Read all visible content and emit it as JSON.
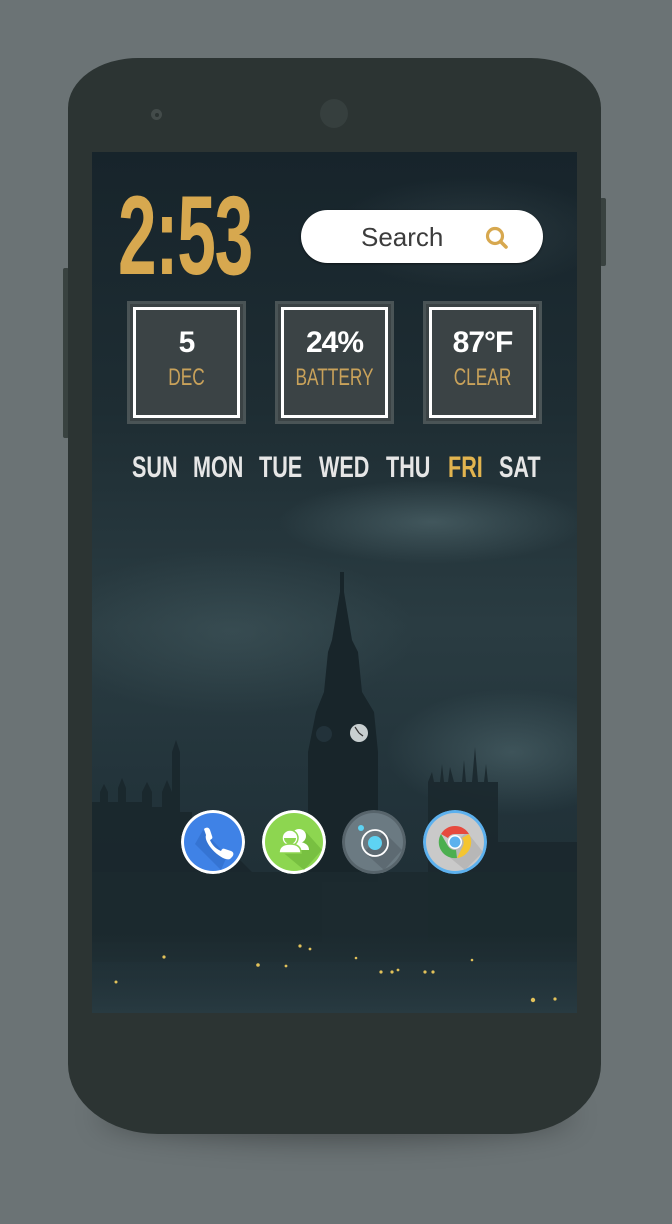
{
  "clock": {
    "time": "2:53"
  },
  "search": {
    "label": "Search",
    "icon": "search-icon",
    "icon_color": "#d7a84f"
  },
  "stats": [
    {
      "value": "5",
      "label": "DEC"
    },
    {
      "value": "24%",
      "label": "BATTERY"
    },
    {
      "value": "87°F",
      "label": "CLEAR"
    }
  ],
  "week": {
    "days": [
      "SUN",
      "MON",
      "TUE",
      "WED",
      "THU",
      "FRI",
      "SAT"
    ],
    "active_day": "FRI",
    "active_color": "#e2b44f"
  },
  "dock": [
    {
      "app": "phone",
      "icon": "phone-icon",
      "color": "#3f82e6"
    },
    {
      "app": "contacts",
      "icon": "contacts-icon",
      "color": "#8dd650"
    },
    {
      "app": "camera",
      "icon": "camera-icon",
      "color": "#6b7a82"
    },
    {
      "app": "chrome",
      "icon": "chrome-icon",
      "color": "#c9c9c9"
    }
  ],
  "colors": {
    "accent": "#d7a84f",
    "frame": "#2c3433",
    "background": "#6b7375"
  }
}
